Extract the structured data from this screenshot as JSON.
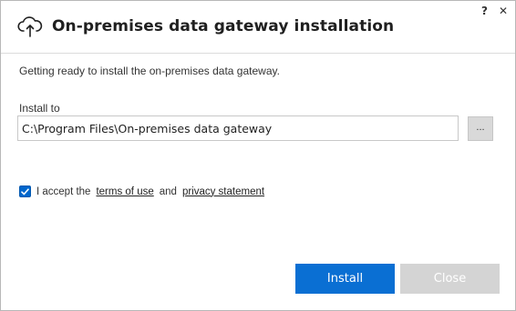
{
  "window": {
    "help_label": "?",
    "close_label": "✕",
    "title": "On-premises data gateway installation",
    "header_icon": "cloud-upload-icon"
  },
  "content": {
    "intro_text": "Getting ready to install the on-premises data gateway.",
    "install_to_label": "Install to",
    "install_path": "C:\\Program Files\\On-premises data gateway",
    "browse_label": "...",
    "accept": {
      "checked": true,
      "prefix": "I accept the",
      "terms_link": "terms of use",
      "conjunction": "and",
      "privacy_link": "privacy statement"
    }
  },
  "buttons": {
    "install_label": "Install",
    "close_label": "Close"
  },
  "colors": {
    "primary": "#0a6fd3",
    "disabled": "#d4d4d4",
    "checkbox": "#0066cc"
  }
}
